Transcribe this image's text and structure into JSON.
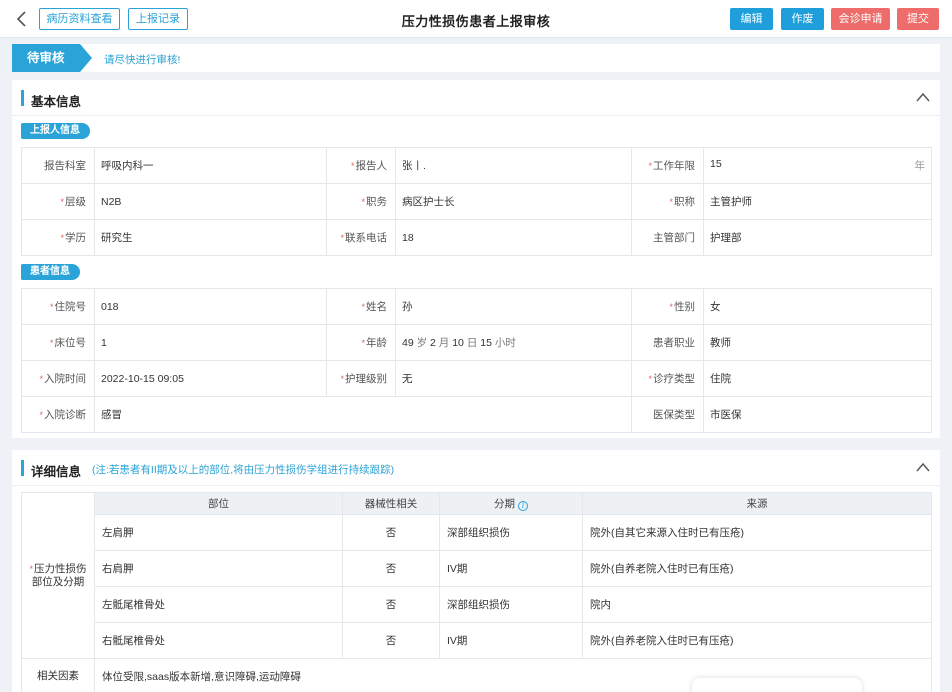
{
  "header": {
    "title": "压力性损伤患者上报审核",
    "left_buttons": [
      "病历资料查看",
      "上报记录"
    ],
    "right_buttons": [
      {
        "label": "编辑",
        "color": "#1e9fdc"
      },
      {
        "label": "作废",
        "color": "#1e9fdc"
      },
      {
        "label": "会诊申请",
        "color": "#ee6d6a"
      },
      {
        "label": "提交",
        "color": "#ee6d6a"
      }
    ]
  },
  "status": {
    "badge": "待审核",
    "hint": "请尽快进行审核!"
  },
  "basic": {
    "title": "基本信息",
    "reporter_tag": "上报人信息",
    "patient_tag": "患者信息",
    "reporter_rows": [
      [
        {
          "label": "报告科室",
          "value": "呼吸内科一",
          "required": false
        },
        {
          "label": "报告人",
          "value": "张丨.",
          "required": true
        },
        {
          "label": "工作年限",
          "value": "15",
          "unit": "年",
          "required": true
        }
      ],
      [
        {
          "label": "层级",
          "value": "N2B",
          "required": true
        },
        {
          "label": "职务",
          "value": "病区护士长",
          "required": true
        },
        {
          "label": "职称",
          "value": "主管护师",
          "required": true
        }
      ],
      [
        {
          "label": "学历",
          "value": "研究生",
          "required": true
        },
        {
          "label": "联系电话",
          "value": "18",
          "required": true
        },
        {
          "label": "主管部门",
          "value": "护理部",
          "required": false
        }
      ]
    ],
    "patient_rows": [
      [
        {
          "label": "住院号",
          "value": "018",
          "required": true
        },
        {
          "label": "姓名",
          "value": "孙",
          "required": true
        },
        {
          "label": "性别",
          "value": "女",
          "required": true
        }
      ],
      [
        {
          "label": "床位号",
          "value": "1",
          "required": true
        },
        {
          "label": "年龄",
          "value": "",
          "required": true
        },
        {
          "label": "患者职业",
          "value": "教师",
          "required": false
        }
      ],
      [
        {
          "label": "入院时间",
          "value": "2022-10-15 09:05",
          "required": true
        },
        {
          "label": "护理级别",
          "value": "无",
          "required": true
        },
        {
          "label": "诊疗类型",
          "value": "住院",
          "required": true
        }
      ]
    ],
    "age": {
      "years": "49",
      "years_unit": "岁",
      "months": "2",
      "months_unit": "月",
      "days": "10",
      "days_unit": "日",
      "hours": "15",
      "hours_unit": "小时"
    },
    "diagnosis": {
      "label": "入院诊断",
      "value": "感冒",
      "required": true
    },
    "insurance": {
      "label": "医保类型",
      "value": "市医保",
      "required": false
    }
  },
  "detail": {
    "title": "详细信息",
    "note": "(注:若患者有II期及以上的部位,将由压力性损伤学组进行持续跟踪)",
    "row_label": "压力性损伤部位及分期",
    "columns": [
      "部位",
      "器械性相关",
      "分期",
      "来源"
    ],
    "rows": [
      {
        "site": "左肩胛",
        "device": "否",
        "stage": "深部组织损伤",
        "source": "院外(自其它来源入住时已有压疮)"
      },
      {
        "site": "右肩胛",
        "device": "否",
        "stage": "IV期",
        "source": "院外(自养老院入住时已有压疮)"
      },
      {
        "site": "左骶尾椎骨处",
        "device": "否",
        "stage": "深部组织损伤",
        "source": "院内"
      },
      {
        "site": "右骶尾椎骨处",
        "device": "否",
        "stage": "IV期",
        "source": "院外(自养老院入住时已有压疮)"
      }
    ],
    "factors_label": "相关因素",
    "factors_value": "体位受限,saas版本新增,意识障碍,运动障碍"
  }
}
